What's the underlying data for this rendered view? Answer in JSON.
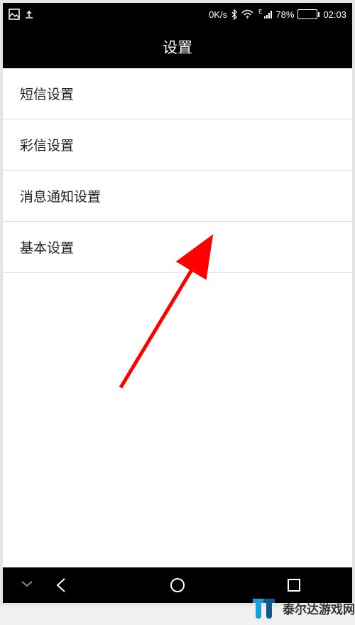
{
  "statusBar": {
    "dataSpeed": "0K/s",
    "networkType": "E",
    "batteryPercent": "78%",
    "time": "02:03"
  },
  "titleBar": {
    "title": "设置"
  },
  "settingsItems": [
    {
      "label": "短信设置"
    },
    {
      "label": "彩信设置"
    },
    {
      "label": "消息通知设置"
    },
    {
      "label": "基本设置"
    }
  ],
  "watermark": {
    "text": "泰尔达游戏网"
  }
}
